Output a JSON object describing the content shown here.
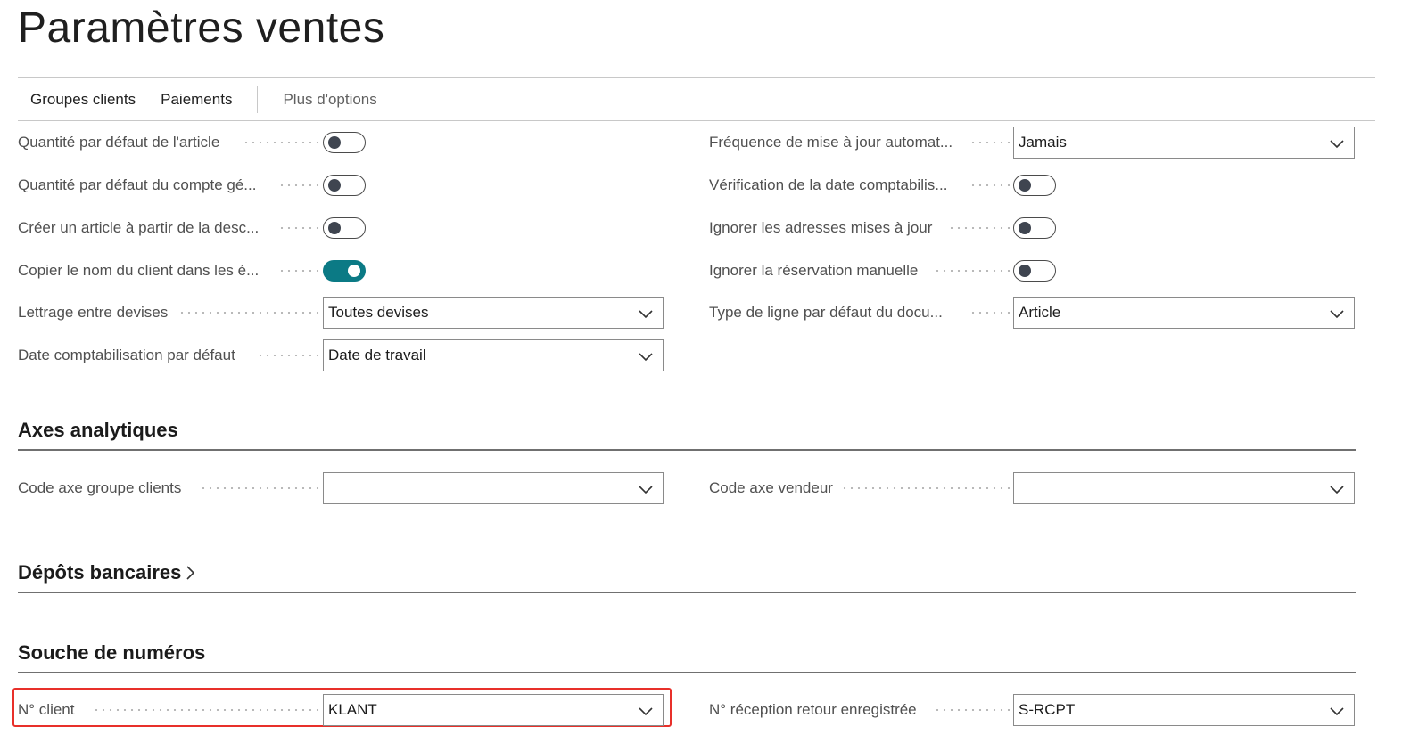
{
  "page": {
    "title": "Paramètres ventes"
  },
  "actions": {
    "customer_groups": "Groupes clients",
    "payments": "Paiements",
    "more_options": "Plus d'options"
  },
  "general": {
    "default_qty_item": {
      "label": "Quantité par défaut de l'article",
      "value": false
    },
    "default_qty_gl": {
      "label": "Quantité par défaut du compte gé...",
      "value": false
    },
    "create_item_from_desc": {
      "label": "Créer un article à partir de la desc...",
      "value": false
    },
    "copy_customer_name": {
      "label": "Copier le nom du client dans les é...",
      "value": true
    },
    "appln_between_currencies": {
      "label": "Lettrage entre devises",
      "value": "Toutes devises"
    },
    "default_posting_date": {
      "label": "Date comptabilisation par défaut",
      "value": "Date de travail"
    },
    "update_frequency": {
      "label": "Fréquence de mise à jour automat...",
      "value": "Jamais"
    },
    "check_posting_date": {
      "label": "Vérification de la date comptabilis...",
      "value": false
    },
    "ignore_updated_addresses": {
      "label": "Ignorer les adresses mises à jour",
      "value": false
    },
    "ignore_manual_reservation": {
      "label": "Ignorer la réservation manuelle",
      "value": false
    },
    "default_line_type": {
      "label": "Type de ligne par défaut du docu...",
      "value": "Article"
    }
  },
  "dimensions": {
    "title": "Axes analytiques",
    "customer_group_dim": {
      "label": "Code axe groupe clients",
      "value": ""
    },
    "salesperson_dim": {
      "label": "Code axe vendeur",
      "value": ""
    }
  },
  "bank_deposits": {
    "title": "Dépôts bancaires",
    "chevron": ">"
  },
  "number_series": {
    "title": "Souche de numéros",
    "customer_nos": {
      "label": "N° client",
      "value": "KLANT"
    },
    "posted_return_receipt_nos": {
      "label": "N° réception retour enregistrée",
      "value": "S-RCPT"
    }
  },
  "colors": {
    "toggle_on": "#0b7a85",
    "highlight": "#e8302a"
  },
  "icons": {
    "dropdown": "chevron-down-icon",
    "expand": "chevron-right-icon"
  }
}
